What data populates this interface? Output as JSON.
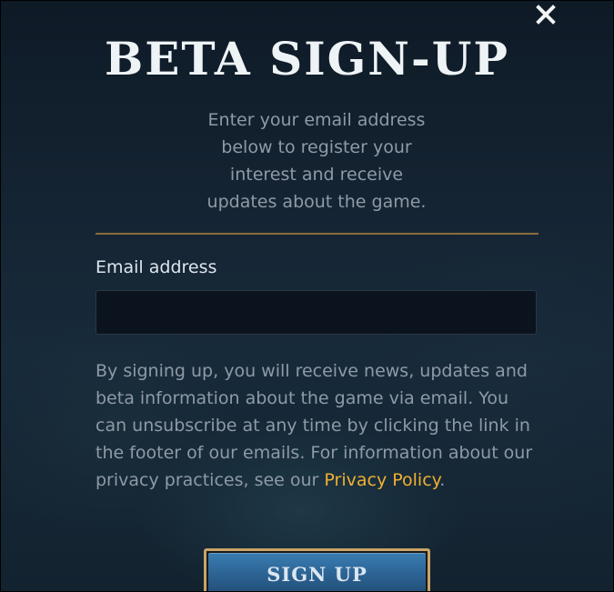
{
  "modal": {
    "title": "BETA SIGN-UP",
    "intro_lines": [
      "Enter your email address",
      "below to register your",
      "interest and receive",
      "updates about the game."
    ],
    "close_icon": "close-icon",
    "email_label": "Email address",
    "email_value": "",
    "email_placeholder": "",
    "disclaimer_text": "By signing up, you will receive news, updates and beta information about the game via email. You can unsubscribe at any time by clicking the link in the footer of our emails. For information about our privacy practices, see our ",
    "privacy_link": "Privacy Policy",
    "disclaimer_end": ".",
    "signup_label": "SIGN UP",
    "colors": {
      "accent_gold": "#f0b030",
      "divider_gold": "#8a6e3c",
      "button_blue": "#2a5f8e"
    }
  }
}
